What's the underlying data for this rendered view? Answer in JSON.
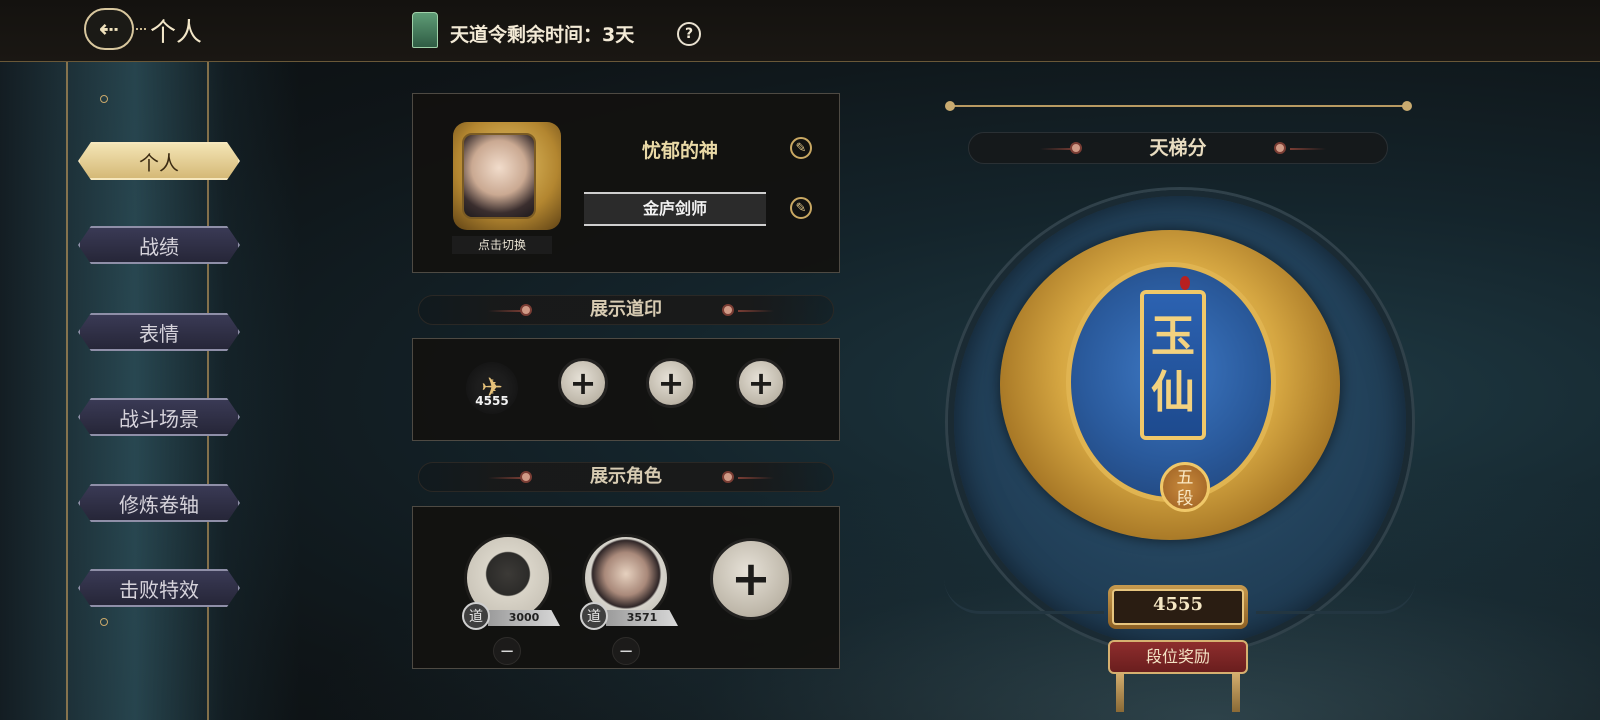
{
  "header": {
    "back_icon": "back-arrow-icon",
    "title": "个人",
    "token_text": "天道令剩余时间：3天",
    "help_label": "?"
  },
  "sidebar": {
    "items": [
      {
        "label": "个人",
        "active": true
      },
      {
        "label": "战绩",
        "active": false
      },
      {
        "label": "表情",
        "active": false
      },
      {
        "label": "战斗场景",
        "active": false
      },
      {
        "label": "修炼卷轴",
        "active": false
      },
      {
        "label": "击败特效",
        "active": false
      }
    ]
  },
  "profile": {
    "avatar_caption": "点击切换",
    "name": "忧郁的神",
    "title": "金庐剑师",
    "edit_icon": "brush-edit-icon"
  },
  "seals": {
    "heading": "展示道印",
    "items": [
      {
        "score": "4555",
        "icon": "crane-seal-icon"
      },
      {
        "add_label": "+"
      },
      {
        "add_label": "+"
      },
      {
        "add_label": "+"
      }
    ]
  },
  "roles": {
    "heading": "展示角色",
    "items": [
      {
        "badge": "道",
        "score": "3000",
        "remove_label": "−"
      },
      {
        "badge": "道",
        "score": "3571",
        "remove_label": "−"
      }
    ],
    "add_label": "+"
  },
  "ladder": {
    "heading": "天梯分",
    "rank_glyph_1": "玉",
    "rank_glyph_2": "仙",
    "tier_line1": "五",
    "tier_line2": "段",
    "score": "4555",
    "reward_button": "段位奖励"
  },
  "colors": {
    "gold": "#e6c27a",
    "active_menu": "#e8d4a0",
    "panel_bg": "#12110f",
    "medal_blue": "#2a5a9c"
  }
}
